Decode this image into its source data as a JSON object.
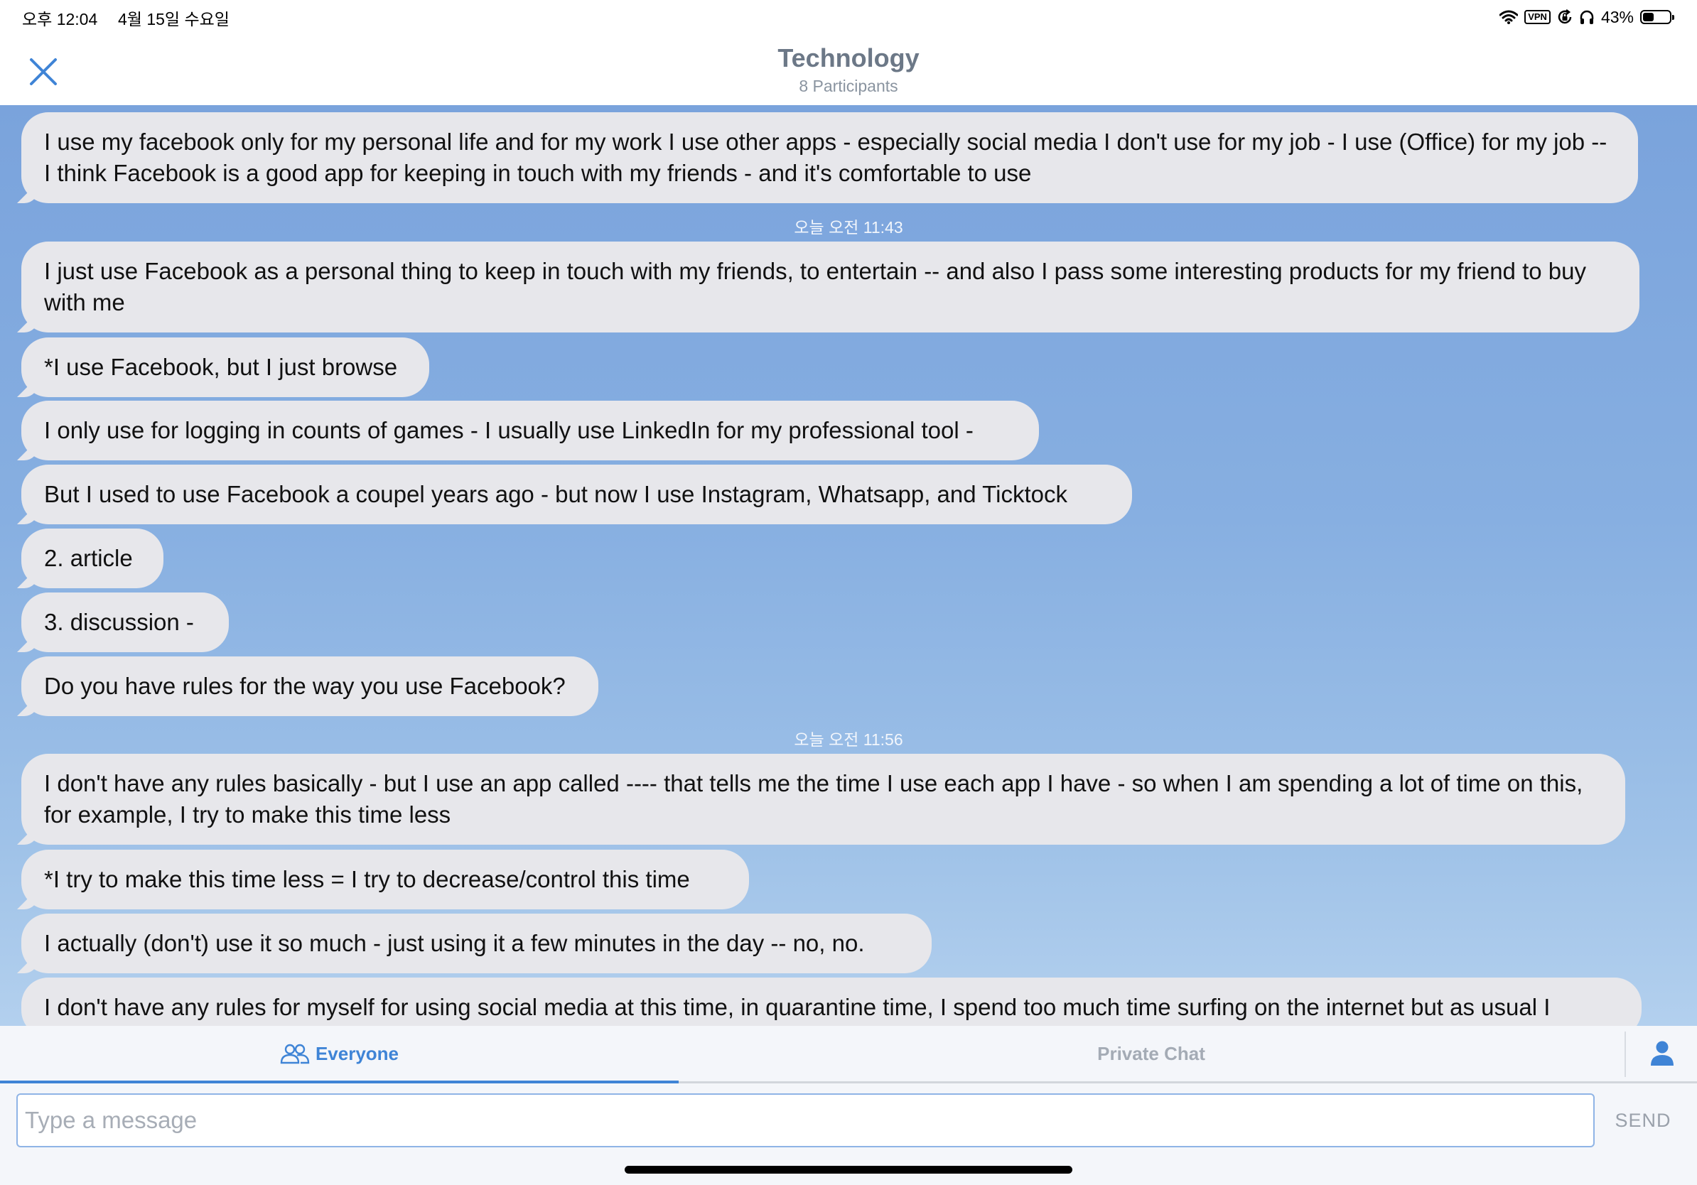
{
  "status_bar": {
    "time": "오후 12:04",
    "date": "4월 15일 수요일",
    "vpn_label": "VPN",
    "battery_percent": "43%",
    "battery_level": 0.43,
    "icons": [
      "wifi-icon",
      "vpn-icon",
      "orientation-lock-icon",
      "headphones-icon",
      "battery-icon"
    ]
  },
  "header": {
    "title": "Technology",
    "subtitle": "8 Participants",
    "close_icon": "close-icon"
  },
  "messages": [
    {
      "type": "bubble",
      "text": "I use my facebook only for my personal life and for my work I use other apps - especially social media I don't use for my job - I use (Office) for my job  -- I think Facebook is a good app for keeping in touch with my friends - and it's comfortable to use"
    },
    {
      "type": "timestamp",
      "text": "오늘 오전 11:43"
    },
    {
      "type": "bubble",
      "text": "I just use Facebook as a personal thing to keep in touch with my friends, to entertain -- and also I pass some interesting products for my friend to buy with me"
    },
    {
      "type": "bubble",
      "text": "*I use Facebook, but I just browse"
    },
    {
      "type": "bubble",
      "text": "I only use for logging in counts of games - I usually use LinkedIn for my professional tool -"
    },
    {
      "type": "bubble",
      "text": "But I used to use Facebook a coupel years ago - but now I use Instagram, Whatsapp, and Ticktock"
    },
    {
      "type": "bubble",
      "text": "2. article"
    },
    {
      "type": "bubble",
      "text": "3. discussion -"
    },
    {
      "type": "bubble",
      "text": "Do you have rules for the way you use Facebook?"
    },
    {
      "type": "timestamp",
      "text": "오늘 오전 11:56"
    },
    {
      "type": "bubble",
      "text": "I don't have any rules basically - but I use an app called ---- that tells me the time I use each app I have - so when I am spending a lot of time on this, for example, I try to make this time less"
    },
    {
      "type": "bubble",
      "text": "*I try to make this time less = I try to decrease/control this time"
    },
    {
      "type": "bubble",
      "text": "I actually (don't) use it so much - just using it a few minutes in the day -- no, no."
    },
    {
      "type": "bubble",
      "text": "I don't have any rules for myself for using social media at this time, in quarantine time, I spend too much time surfing on the internet but as usual I"
    }
  ],
  "tabs": {
    "everyone": {
      "label": "Everyone",
      "icon": "people-icon",
      "active": true
    },
    "private": {
      "label": "Private Chat",
      "active": false
    },
    "participants_icon": "person-icon"
  },
  "composer": {
    "value": "",
    "placeholder": "Type a message",
    "send_label": "SEND"
  },
  "colors": {
    "accent": "#3f84d6",
    "bubble": "#e7e7eb",
    "title": "#6c7887"
  }
}
